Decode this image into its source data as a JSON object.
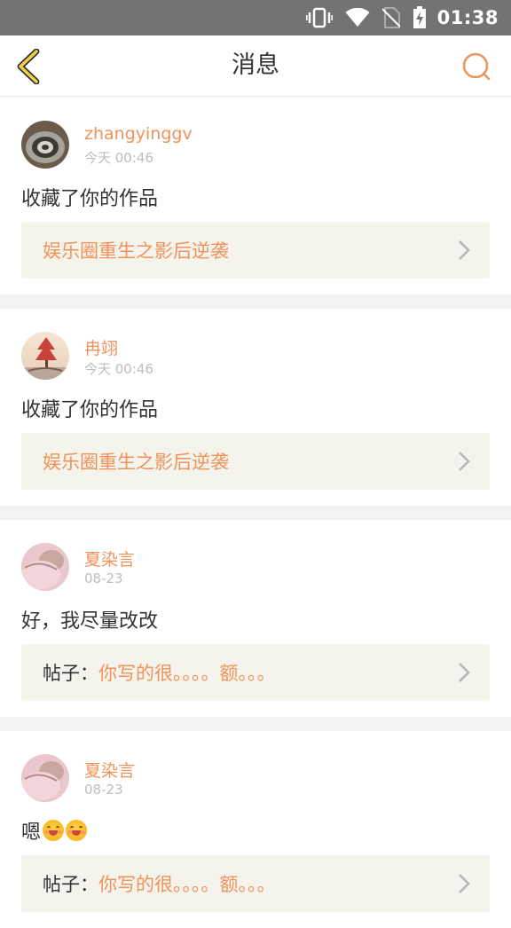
{
  "status_bar": {
    "time": "01:38",
    "icons": [
      "vibrate-icon",
      "wifi-icon",
      "no-sim-icon",
      "battery-charging-icon"
    ]
  },
  "nav": {
    "title": "消息",
    "back_icon": "chevron-left-icon",
    "search_icon": "search-icon"
  },
  "colors": {
    "accent": "#f0935a",
    "text": "#333333",
    "muted": "#bdbdbd",
    "link_bg": "#f4f3ec",
    "status_bar": "#737373",
    "divider": "#f2f2f2"
  },
  "messages": [
    {
      "username": "zhangyinggv",
      "time": "今天 00:46",
      "text": "收藏了你的作品",
      "link_prefix": "",
      "link_title": "娱乐圈重生之影后逆袭"
    },
    {
      "username": "冉翊",
      "time": "今天 00:46",
      "text": "收藏了你的作品",
      "link_prefix": "",
      "link_title": "娱乐圈重生之影后逆袭"
    },
    {
      "username": "夏染言",
      "time": "08-23",
      "text": "好，我尽量改改",
      "link_prefix": "帖子：",
      "link_title": "你写的很。。。。额。。。"
    },
    {
      "username": "夏染言",
      "time": "08-23",
      "text": "嗯",
      "emoji": [
        "smile-emoji",
        "smile-emoji"
      ],
      "link_prefix": "帖子：",
      "link_title": "你写的很。。。。额。。。"
    }
  ]
}
